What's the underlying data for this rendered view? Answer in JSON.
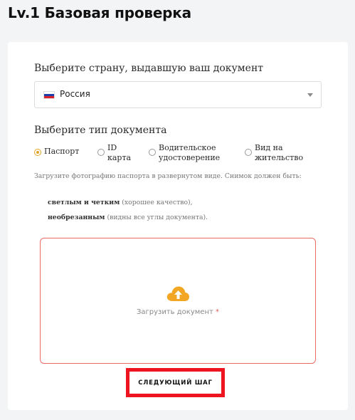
{
  "page": {
    "title": "Lv.1 Базовая проверка"
  },
  "form": {
    "country_label": "Выберите страну, выдавшую ваш документ",
    "country_select": {
      "value": "Россия",
      "flag_colors": [
        "#ffffff",
        "#1c3fa8",
        "#d8232a"
      ]
    },
    "doctype_label": "Выберите тип документа",
    "doc_types": [
      {
        "line1": "Паспорт",
        "line2": "",
        "checked": true
      },
      {
        "line1": "ID",
        "line2": "карта",
        "checked": false
      },
      {
        "line1": "Водительское",
        "line2": "удостоверение",
        "checked": false
      },
      {
        "line1": "Вид на",
        "line2": "жительство",
        "checked": false
      }
    ],
    "hint": "Загрузите фотографию паспорта в развернутом виде. Снимок должен быть:",
    "requirements": [
      {
        "bold": "светлым и четким",
        "rest": " (хорошее качество),"
      },
      {
        "bold": "необрезанным",
        "rest": " (видны все углы документа)."
      }
    ],
    "upload": {
      "label": "Загрузить документ",
      "required_mark": "*",
      "icon": "cloud-upload-icon"
    },
    "next_button": "СЛЕДУЮЩИЙ ШАГ"
  },
  "colors": {
    "accent": "#e0a527",
    "error_border": "#e96a63",
    "highlight": "#ee1520"
  }
}
